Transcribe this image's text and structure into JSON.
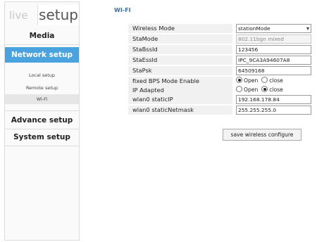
{
  "tabs": {
    "live": "live",
    "setup": "setup"
  },
  "nav": {
    "media": "Media",
    "network_setup": "Network setup",
    "sub_items": [
      "Local setup",
      "Remote setup",
      "Wi-Fi"
    ],
    "advance_setup": "Advance setup",
    "system_setup": "System setup"
  },
  "section_title": "WI-FI",
  "form": {
    "wireless_mode": {
      "label": "Wireless Mode",
      "value": "stationMode"
    },
    "sta_mode": {
      "label": "StaMode",
      "value": "802.11bgn mixed"
    },
    "sta_bssid": {
      "label": "StaBssId",
      "value": "123456"
    },
    "sta_essid": {
      "label": "StaEssId",
      "value": "IPC_9CA3A94607A8"
    },
    "sta_psk": {
      "label": "StaPsk",
      "value": "64509168"
    },
    "fixed_bps": {
      "label": "fixed BPS Mode Enable",
      "open": "Open",
      "close": "close",
      "selected": "Open"
    },
    "ip_adapted": {
      "label": "IP Adapted",
      "open": "Open",
      "close": "close",
      "selected": "close"
    },
    "static_ip": {
      "label": "wlan0 staticIP",
      "value": "192.168.178.84"
    },
    "static_netmask": {
      "label": "wlan0 staticNetmask",
      "value": "255.255.255.0"
    }
  },
  "save_button": "save wireless configure"
}
